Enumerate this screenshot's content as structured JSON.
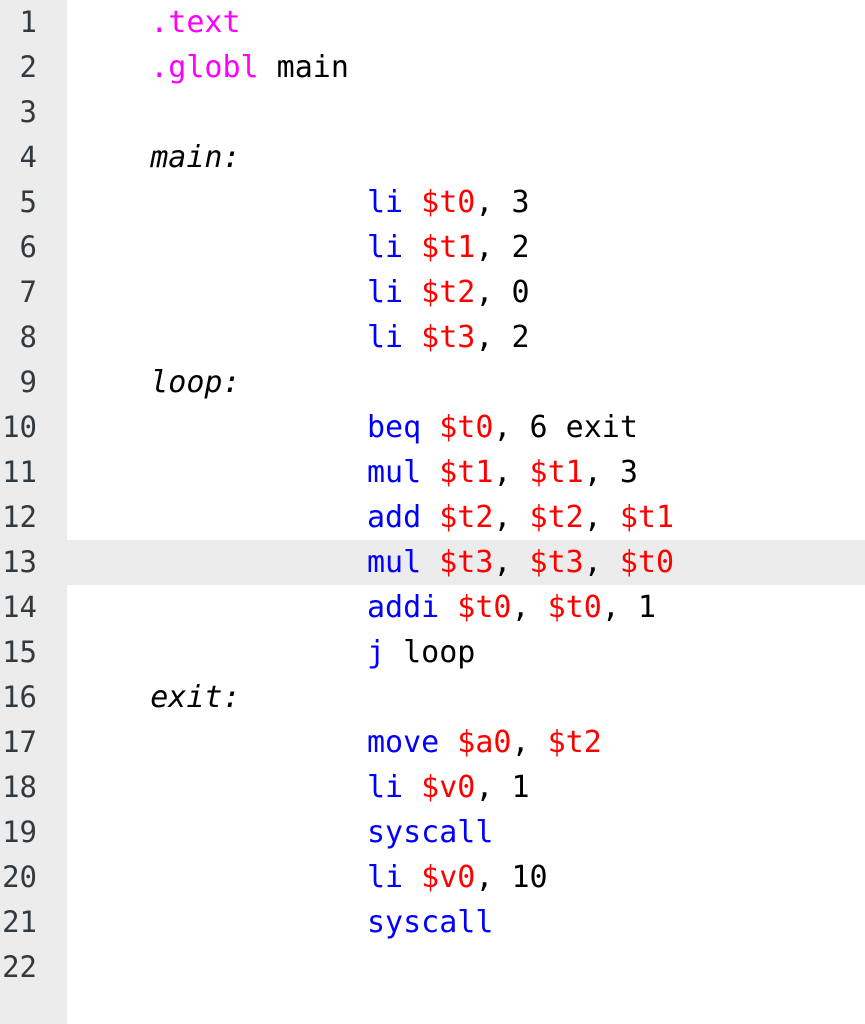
{
  "editor": {
    "language": "MIPS Assembly",
    "active_line": 13,
    "total_lines": 22,
    "colors": {
      "background": "#ffffff",
      "gutter_background": "#ececec",
      "active_line_highlight": "#ececec",
      "line_number_text": "#333a3f",
      "directive": "#ff00ff",
      "instruction": "#0000ff",
      "register": "#ff0000",
      "plain_text": "#000000"
    },
    "indent": "            "
  },
  "lines": [
    {
      "number": "1",
      "active": false,
      "tokens": [
        {
          "text": "    ",
          "type": "plain"
        },
        {
          "text": ".text",
          "type": "directive"
        }
      ]
    },
    {
      "number": "2",
      "active": false,
      "tokens": [
        {
          "text": "    ",
          "type": "plain"
        },
        {
          "text": ".globl",
          "type": "directive"
        },
        {
          "text": " main",
          "type": "plain"
        }
      ]
    },
    {
      "number": "3",
      "active": false,
      "tokens": []
    },
    {
      "number": "4",
      "active": false,
      "tokens": [
        {
          "text": "    ",
          "type": "plain"
        },
        {
          "text": "main:",
          "type": "label"
        }
      ]
    },
    {
      "number": "5",
      "active": false,
      "tokens": [
        {
          "text": "                ",
          "type": "plain"
        },
        {
          "text": "li",
          "type": "instr"
        },
        {
          "text": " ",
          "type": "plain"
        },
        {
          "text": "$t0",
          "type": "reg"
        },
        {
          "text": ", 3",
          "type": "plain"
        }
      ]
    },
    {
      "number": "6",
      "active": false,
      "tokens": [
        {
          "text": "                ",
          "type": "plain"
        },
        {
          "text": "li",
          "type": "instr"
        },
        {
          "text": " ",
          "type": "plain"
        },
        {
          "text": "$t1",
          "type": "reg"
        },
        {
          "text": ", 2",
          "type": "plain"
        }
      ]
    },
    {
      "number": "7",
      "active": false,
      "tokens": [
        {
          "text": "                ",
          "type": "plain"
        },
        {
          "text": "li",
          "type": "instr"
        },
        {
          "text": " ",
          "type": "plain"
        },
        {
          "text": "$t2",
          "type": "reg"
        },
        {
          "text": ", 0",
          "type": "plain"
        }
      ]
    },
    {
      "number": "8",
      "active": false,
      "tokens": [
        {
          "text": "                ",
          "type": "plain"
        },
        {
          "text": "li",
          "type": "instr"
        },
        {
          "text": " ",
          "type": "plain"
        },
        {
          "text": "$t3",
          "type": "reg"
        },
        {
          "text": ", 2",
          "type": "plain"
        }
      ]
    },
    {
      "number": "9",
      "active": false,
      "tokens": [
        {
          "text": "    ",
          "type": "plain"
        },
        {
          "text": "loop:",
          "type": "label"
        }
      ]
    },
    {
      "number": "10",
      "active": false,
      "tokens": [
        {
          "text": "                ",
          "type": "plain"
        },
        {
          "text": "beq",
          "type": "instr"
        },
        {
          "text": " ",
          "type": "plain"
        },
        {
          "text": "$t0",
          "type": "reg"
        },
        {
          "text": ", 6 exit",
          "type": "plain"
        }
      ]
    },
    {
      "number": "11",
      "active": false,
      "tokens": [
        {
          "text": "                ",
          "type": "plain"
        },
        {
          "text": "mul",
          "type": "instr"
        },
        {
          "text": " ",
          "type": "plain"
        },
        {
          "text": "$t1",
          "type": "reg"
        },
        {
          "text": ", ",
          "type": "plain"
        },
        {
          "text": "$t1",
          "type": "reg"
        },
        {
          "text": ", 3",
          "type": "plain"
        }
      ]
    },
    {
      "number": "12",
      "active": false,
      "tokens": [
        {
          "text": "                ",
          "type": "plain"
        },
        {
          "text": "add",
          "type": "instr"
        },
        {
          "text": " ",
          "type": "plain"
        },
        {
          "text": "$t2",
          "type": "reg"
        },
        {
          "text": ", ",
          "type": "plain"
        },
        {
          "text": "$t2",
          "type": "reg"
        },
        {
          "text": ", ",
          "type": "plain"
        },
        {
          "text": "$t1",
          "type": "reg"
        }
      ]
    },
    {
      "number": "13",
      "active": true,
      "tokens": [
        {
          "text": "                ",
          "type": "plain"
        },
        {
          "text": "mul",
          "type": "instr"
        },
        {
          "text": " ",
          "type": "plain"
        },
        {
          "text": "$t3",
          "type": "reg"
        },
        {
          "text": ", ",
          "type": "plain"
        },
        {
          "text": "$t3",
          "type": "reg"
        },
        {
          "text": ", ",
          "type": "plain"
        },
        {
          "text": "$t0",
          "type": "reg"
        }
      ]
    },
    {
      "number": "14",
      "active": false,
      "tokens": [
        {
          "text": "                ",
          "type": "plain"
        },
        {
          "text": "addi",
          "type": "instr"
        },
        {
          "text": " ",
          "type": "plain"
        },
        {
          "text": "$t0",
          "type": "reg"
        },
        {
          "text": ", ",
          "type": "plain"
        },
        {
          "text": "$t0",
          "type": "reg"
        },
        {
          "text": ", 1",
          "type": "plain"
        }
      ]
    },
    {
      "number": "15",
      "active": false,
      "tokens": [
        {
          "text": "                ",
          "type": "plain"
        },
        {
          "text": "j",
          "type": "instr"
        },
        {
          "text": " loop",
          "type": "plain"
        }
      ]
    },
    {
      "number": "16",
      "active": false,
      "tokens": [
        {
          "text": "    ",
          "type": "plain"
        },
        {
          "text": "exit:",
          "type": "label"
        }
      ]
    },
    {
      "number": "17",
      "active": false,
      "tokens": [
        {
          "text": "                ",
          "type": "plain"
        },
        {
          "text": "move",
          "type": "instr"
        },
        {
          "text": " ",
          "type": "plain"
        },
        {
          "text": "$a0",
          "type": "reg"
        },
        {
          "text": ", ",
          "type": "plain"
        },
        {
          "text": "$t2",
          "type": "reg"
        }
      ]
    },
    {
      "number": "18",
      "active": false,
      "tokens": [
        {
          "text": "                ",
          "type": "plain"
        },
        {
          "text": "li",
          "type": "instr"
        },
        {
          "text": " ",
          "type": "plain"
        },
        {
          "text": "$v0",
          "type": "reg"
        },
        {
          "text": ", 1",
          "type": "plain"
        }
      ]
    },
    {
      "number": "19",
      "active": false,
      "tokens": [
        {
          "text": "                ",
          "type": "plain"
        },
        {
          "text": "syscall",
          "type": "instr"
        }
      ]
    },
    {
      "number": "20",
      "active": false,
      "tokens": [
        {
          "text": "                ",
          "type": "plain"
        },
        {
          "text": "li",
          "type": "instr"
        },
        {
          "text": " ",
          "type": "plain"
        },
        {
          "text": "$v0",
          "type": "reg"
        },
        {
          "text": ", 10",
          "type": "plain"
        }
      ]
    },
    {
      "number": "21",
      "active": false,
      "tokens": [
        {
          "text": "                ",
          "type": "plain"
        },
        {
          "text": "syscall",
          "type": "instr"
        }
      ]
    },
    {
      "number": "22",
      "active": false,
      "tokens": []
    }
  ],
  "source_text": ".text\n.globl main\n\nmain:\n            li $t0, 3\n            li $t1, 2\n            li $t2, 0\n            li $t3, 2\nloop:\n            beq $t0, 6 exit\n            mul $t1, $t1, 3\n            add $t2, $t2, $t1\n            mul $t3, $t3, $t0\n            addi $t0, $t0, 1\n            j loop\nexit:\n            move $a0, $t2\n            li $v0, 1\n            syscall\n            li $v0, 10\n            syscall\n"
}
